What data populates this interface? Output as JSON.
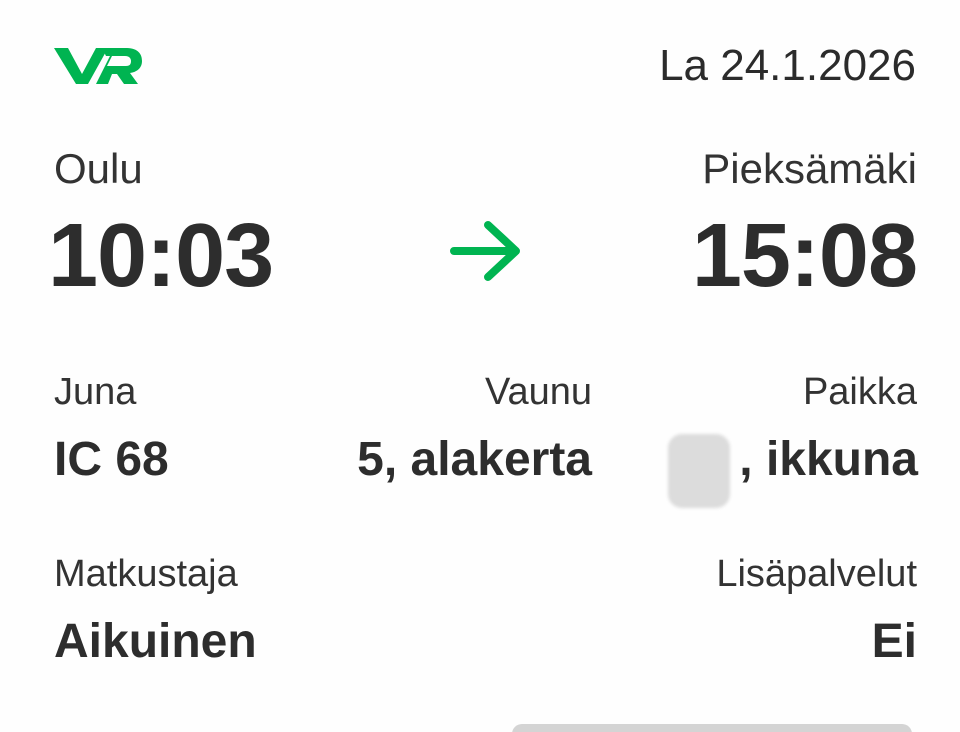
{
  "header": {
    "logo_text": "VR",
    "date": "La 24.1.2026"
  },
  "journey": {
    "from": {
      "station": "Oulu",
      "time": "10:03"
    },
    "to": {
      "station": "Pieksämäki",
      "time": "15:08"
    }
  },
  "details": {
    "train": {
      "label": "Juna",
      "value": "IC 68"
    },
    "car": {
      "label": "Vaunu",
      "value": "5, alakerta"
    },
    "seat": {
      "label": "Paikka",
      "value": ", ikkuna"
    }
  },
  "passenger": {
    "label": "Matkustaja",
    "value": "Aikuinen"
  },
  "extras": {
    "label": "Lisäpalvelut",
    "value": "Ei"
  },
  "colors": {
    "brand_green": "#00b451",
    "text": "#2b2b2b",
    "redaction": "#dcdcdc"
  },
  "icons": {
    "logo": "vr-logo-icon",
    "direction": "arrow-right-icon"
  }
}
